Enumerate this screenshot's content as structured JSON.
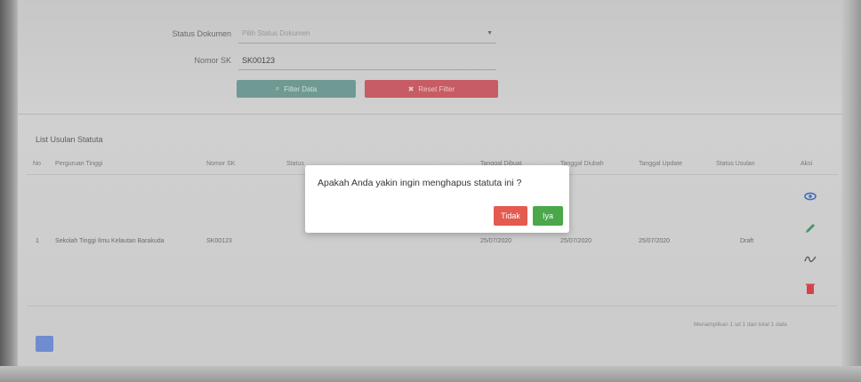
{
  "filters": {
    "status_label": "Status Dokumen",
    "status_placeholder": "Pilih Status Dokumen",
    "nomor_label": "Nomor SK",
    "nomor_value": "SK00123",
    "filter_button": "Filter Data",
    "reset_button": "Reset Filter"
  },
  "list": {
    "title": "List Usulan Statuta",
    "headers": [
      "No",
      "Perguruan Tinggi",
      "Nomor SK",
      "Status",
      "Tanggal Dibuat",
      "Tanggal Diubah",
      "Tanggal Update",
      "Status Usulan",
      "Aksi"
    ],
    "rows": [
      {
        "no": "1",
        "perguruan_tinggi": "Sekolah Tinggi Ilmu Kelautan Barakuda",
        "nomor_sk": "SK00123",
        "tanggal_dibuat": "25/07/2020",
        "tanggal_diubah": "25/07/2020",
        "tanggal_update": "25/07/2020",
        "status_usulan": "Draft"
      }
    ],
    "info": "Menampilkan 1 sd 1 dari total 1 data"
  },
  "dialog": {
    "message": "Apakah Anda yakin ingin menghapus statuta ini ?",
    "no_label": "Tidak",
    "yes_label": "Iya"
  },
  "icons": {
    "view": "eye-icon",
    "edit": "pencil-icon",
    "sign": "signature-icon",
    "delete": "trash-icon"
  },
  "colors": {
    "filter_button": "#6f9e97",
    "reset_button": "#cf5b63",
    "no_button": "#e45a4f",
    "yes_button": "#4aa84a",
    "view_icon": "#3b6fc4",
    "edit_icon": "#3f9a6a",
    "delete_icon": "#d9404a"
  }
}
